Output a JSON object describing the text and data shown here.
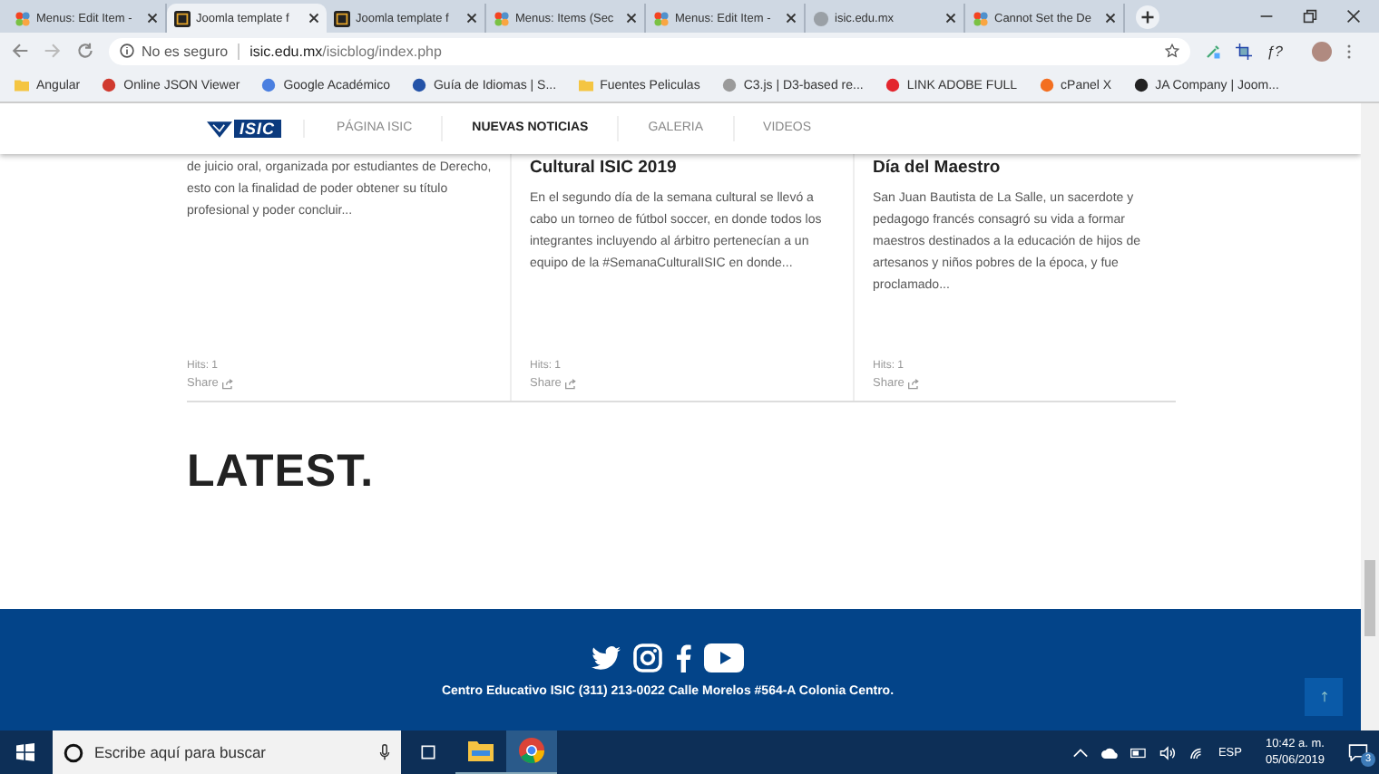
{
  "browser": {
    "tabs": [
      {
        "title": "Menus: Edit Item -",
        "kind": "joomla",
        "selected": false
      },
      {
        "title": "Joomla template f",
        "kind": "dark",
        "selected": true
      },
      {
        "title": "Joomla template f",
        "kind": "dark",
        "selected": false
      },
      {
        "title": "Menus: Items (Sec",
        "kind": "joomla",
        "selected": false
      },
      {
        "title": "Menus: Edit Item -",
        "kind": "joomla",
        "selected": false
      },
      {
        "title": "isic.edu.mx",
        "kind": "globe",
        "selected": false
      },
      {
        "title": "Cannot Set the De",
        "kind": "joomla",
        "selected": false
      }
    ],
    "extension_label": "ƒ?",
    "address": {
      "security": "No es seguro",
      "host": "isic.edu.mx",
      "path": "/isicblog/index.php"
    },
    "bookmarks": [
      {
        "label": "Angular",
        "kind": "folder",
        "color": "#f4c542"
      },
      {
        "label": "Online JSON Viewer",
        "kind": "site",
        "color": "#d03a2f"
      },
      {
        "label": "Google Académico",
        "kind": "site",
        "color": "#4a7fe0"
      },
      {
        "label": "Guía de Idiomas | S...",
        "kind": "site",
        "color": "#2453a8"
      },
      {
        "label": "Fuentes Peliculas",
        "kind": "folder",
        "color": "#f4c542"
      },
      {
        "label": "C3.js | D3-based re...",
        "kind": "site",
        "color": "#9a9a9a"
      },
      {
        "label": "LINK ADOBE FULL",
        "kind": "site",
        "color": "#e3262e"
      },
      {
        "label": "cPanel X",
        "kind": "site",
        "color": "#f36f21"
      },
      {
        "label": "JA Company | Joom...",
        "kind": "site",
        "color": "#222222"
      }
    ]
  },
  "site": {
    "logo": "ISIC",
    "nav": [
      {
        "label": "PÁGINA ISIC",
        "selected": false
      },
      {
        "label": "NUEVAS NOTICIAS",
        "selected": true
      },
      {
        "label": "GALERIA",
        "selected": false
      },
      {
        "label": "VIDEOS",
        "selected": false
      }
    ],
    "articles": [
      {
        "body": "de juicio oral, organizada por estudiantes de Derecho, esto con la finalidad de poder obtener su título profesional y poder concluir...",
        "hits": "Hits: 1",
        "share": "Share"
      },
      {
        "title": "Cultural ISIC 2019",
        "body": "En el segundo día de la semana cultural se llevó a cabo un torneo de fútbol soccer, en donde todos los integrantes incluyendo al árbitro pertenecían a un equipo de la #SemanaCulturalISIC en donde...",
        "hits": "Hits: 1",
        "share": "Share"
      },
      {
        "title": "Día del Maestro",
        "body": "San Juan Bautista de La Salle, un sacerdote y pedagogo francés consagró su vida a formar maestros destinados a la educación de hijos de artesanos y niños pobres de la época, y fue proclamado...",
        "hits": "Hits: 1",
        "share": "Share"
      }
    ],
    "latest_heading": "LATEST.",
    "footer": {
      "address": "Centro Educativo ISIC (311) 213-0022 Calle Morelos #564-A Colonia Centro."
    }
  },
  "taskbar": {
    "search_placeholder": "Escribe aquí para buscar",
    "language": "ESP",
    "time": "10:42 a. m.",
    "date": "05/06/2019",
    "notifications": "3"
  }
}
